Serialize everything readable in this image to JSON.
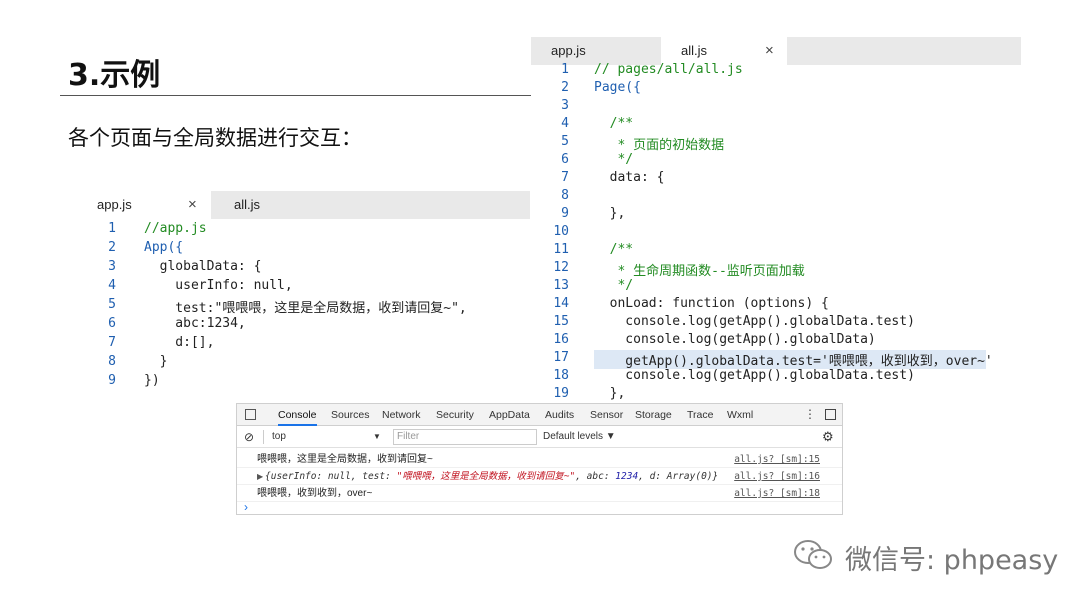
{
  "slide": {
    "title": "3.示例",
    "subtitle": "各个页面与全局数据进行交互："
  },
  "left_editor": {
    "tabs": [
      {
        "label": "app.js",
        "close": "×",
        "active": true
      },
      {
        "label": "all.js",
        "active": false
      }
    ],
    "lines": [
      {
        "n": "1",
        "code": "//app.js"
      },
      {
        "n": "2",
        "code": "App({"
      },
      {
        "n": "3",
        "code": "  globalData: {"
      },
      {
        "n": "4",
        "code": "    userInfo: null,"
      },
      {
        "n": "5",
        "code": "    test:\"喂喂喂，这里是全局数据，收到请回复~\","
      },
      {
        "n": "6",
        "code": "    abc:1234,"
      },
      {
        "n": "7",
        "code": "    d:[],"
      },
      {
        "n": "8",
        "code": "  }"
      },
      {
        "n": "9",
        "code": "})"
      }
    ]
  },
  "right_editor": {
    "tabs": [
      {
        "label": "app.js",
        "active": false
      },
      {
        "label": "all.js",
        "close": "×",
        "active": true
      }
    ],
    "lines": [
      {
        "n": "1",
        "code": "// pages/all/all.js"
      },
      {
        "n": "2",
        "code": "Page({"
      },
      {
        "n": "3",
        "code": ""
      },
      {
        "n": "4",
        "code": "  /**"
      },
      {
        "n": "5",
        "code": "   * 页面的初始数据"
      },
      {
        "n": "6",
        "code": "   */"
      },
      {
        "n": "7",
        "code": "  data: {"
      },
      {
        "n": "8",
        "code": ""
      },
      {
        "n": "9",
        "code": "  },"
      },
      {
        "n": "10",
        "code": ""
      },
      {
        "n": "11",
        "code": "  /**"
      },
      {
        "n": "12",
        "code": "   * 生命周期函数--监听页面加载"
      },
      {
        "n": "13",
        "code": "   */"
      },
      {
        "n": "14",
        "code": "  onLoad: function (options) {"
      },
      {
        "n": "15",
        "code": "    console.log(getApp().globalData.test)"
      },
      {
        "n": "16",
        "code": "    console.log(getApp().globalData)"
      },
      {
        "n": "17",
        "code": "    getApp().globalData.test='喂喂喂，收到收到，over~'"
      },
      {
        "n": "18",
        "code": "    console.log(getApp().globalData.test)"
      },
      {
        "n": "19",
        "code": "  },"
      }
    ]
  },
  "devtools": {
    "tabs": [
      "Console",
      "Sources",
      "Network",
      "Security",
      "AppData",
      "Audits",
      "Sensor",
      "Storage",
      "Trace",
      "Wxml"
    ],
    "active_tab": "Console",
    "context": "top",
    "filter_placeholder": "Filter",
    "levels": "Default levels ▼",
    "messages": [
      {
        "text": "喂喂喂，这里是全局数据，收到请回复~",
        "source": "all.js? [sm]:15"
      },
      {
        "source": "all.js? [sm]:16"
      },
      {
        "text": "喂喂喂，收到收到，over~",
        "source": "all.js? [sm]:18"
      }
    ],
    "object_log": {
      "open": "{userInfo: null, test: ",
      "test": "\"喂喂喂，这里是全局数据，收到请回复~\"",
      "mid": ", abc: ",
      "abc": "1234",
      "end": ", d: Array(0)}"
    },
    "prompt": "›"
  },
  "watermark": {
    "text": "微信号: phpeasy"
  }
}
